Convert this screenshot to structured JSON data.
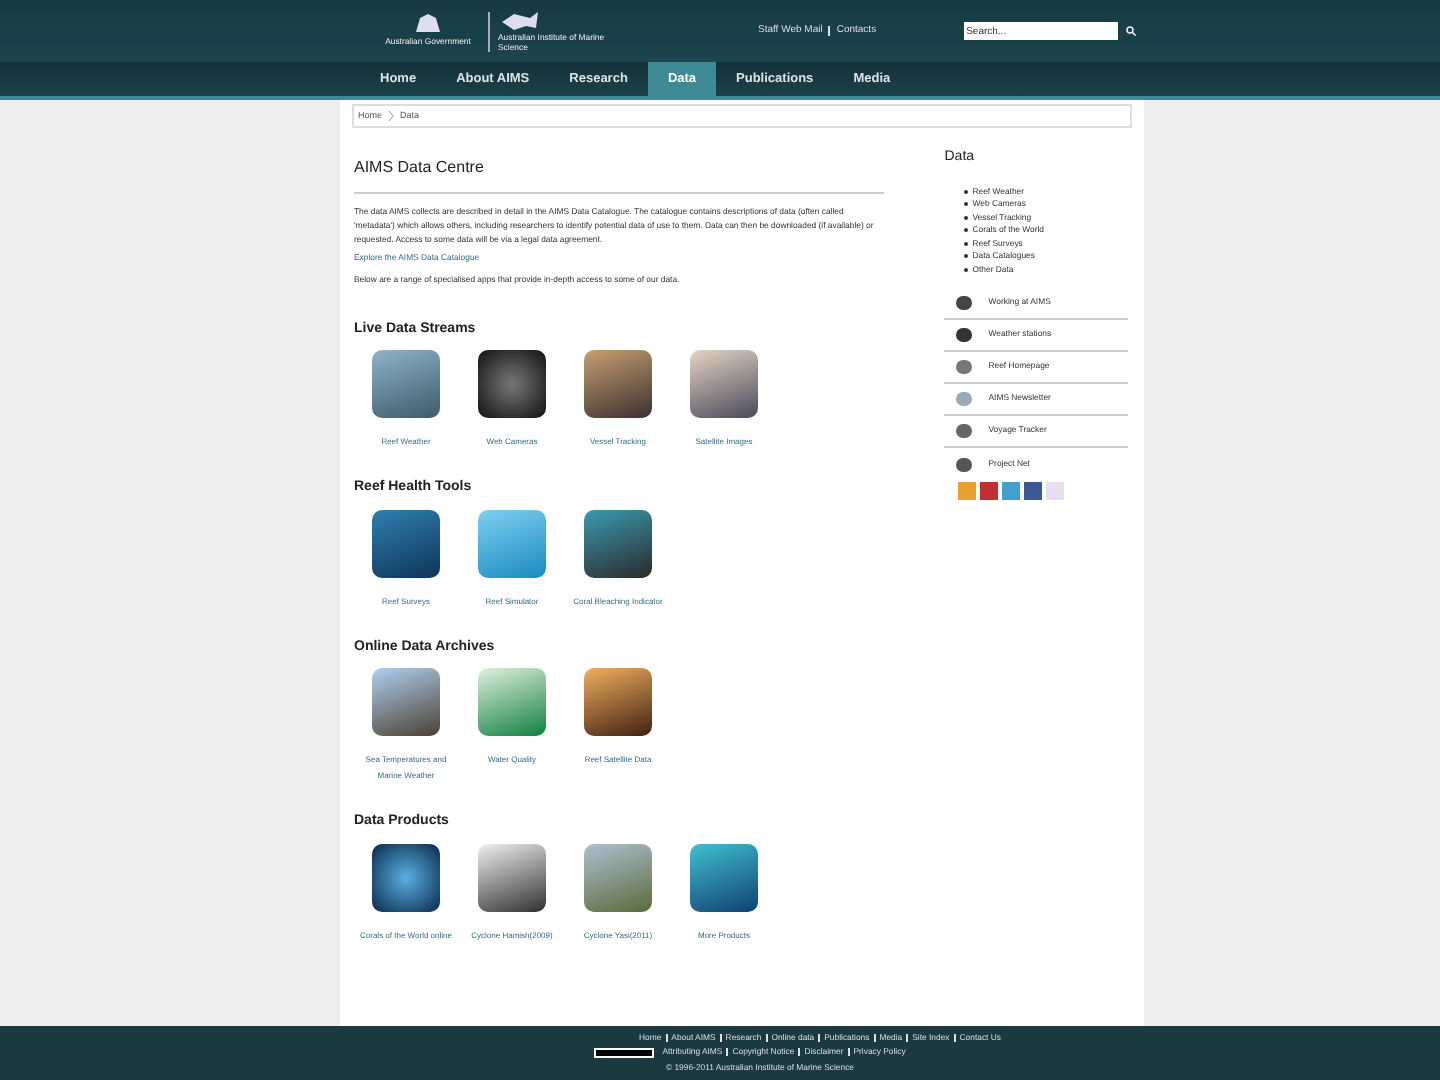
{
  "header": {
    "government_logo_text": "Australian Government",
    "institute_logo_text": "Australian Institute of Marine Science",
    "top_links": [
      "Staff Web Mail",
      "Contacts"
    ],
    "search": {
      "placeholder": "Search..."
    }
  },
  "nav": [
    {
      "label": "Home",
      "selected": false
    },
    {
      "label": "About AIMS",
      "selected": false
    },
    {
      "label": "Research",
      "selected": false
    },
    {
      "label": "Data",
      "selected": true
    },
    {
      "label": "Publications",
      "selected": false
    },
    {
      "label": "Media",
      "selected": false
    }
  ],
  "breadcrumb": [
    "Home",
    "Data"
  ],
  "main": {
    "title": "AIMS Data Centre",
    "paragraph": "The data AIMS collects are described in detail in the AIMS Data Catalogue. The catalogue contains descriptions of data (often called 'metadata') which allows others, including researchers to identify potential data of use to them. Data can then be downloaded (if available) or requested. Access to some data will be via a legal data agreement.",
    "catalogue_link": "Explore the AIMS Data Catalogue",
    "intro": "Below are a range of specialised apps that provide in-depth access to some of our data.",
    "sections": [
      {
        "heading": "Live Data Streams",
        "apps": [
          "Reef Weather",
          "Web Cameras",
          "Vessel Tracking",
          "Satellite Images"
        ]
      },
      {
        "heading": "Reef Health Tools",
        "apps": [
          "Reef Surveys",
          "Reef Simulator",
          "Coral Bleaching Indicator"
        ]
      },
      {
        "heading": "Online Data Archives",
        "apps": [
          "Sea Temperatures and Marine Weather",
          "Water Quality",
          "Reef Satellite Data"
        ]
      },
      {
        "heading": "Data Products",
        "apps": [
          "Corals of the World online",
          "Cyclone Hamish(2009)",
          "Cyclone Yasi(2011)",
          "More Products"
        ]
      }
    ]
  },
  "sidebar": {
    "heading": "Data",
    "links": [
      "Reef Weather",
      "Web Cameras",
      "Vessel Tracking",
      "Corals of the World",
      "Reef Surveys",
      "Data Catalogues",
      "Other Data"
    ],
    "features": [
      "Working at AIMS",
      "Weather stations",
      "Reef Homepage",
      "AIMS Newsletter",
      "Voyage Tracker",
      "Project Net"
    ]
  },
  "footer": {
    "links": [
      "Home",
      "About AIMS",
      "Research",
      "Online data",
      "Publications",
      "Media",
      "Site Index",
      "Contact Us"
    ],
    "links_2": [
      "Attributing AIMS",
      "Copyright Notice",
      "Disclaimer",
      "Privacy Policy"
    ],
    "copyright": "© 1996-2011 Australian Institute of Marine Science"
  }
}
